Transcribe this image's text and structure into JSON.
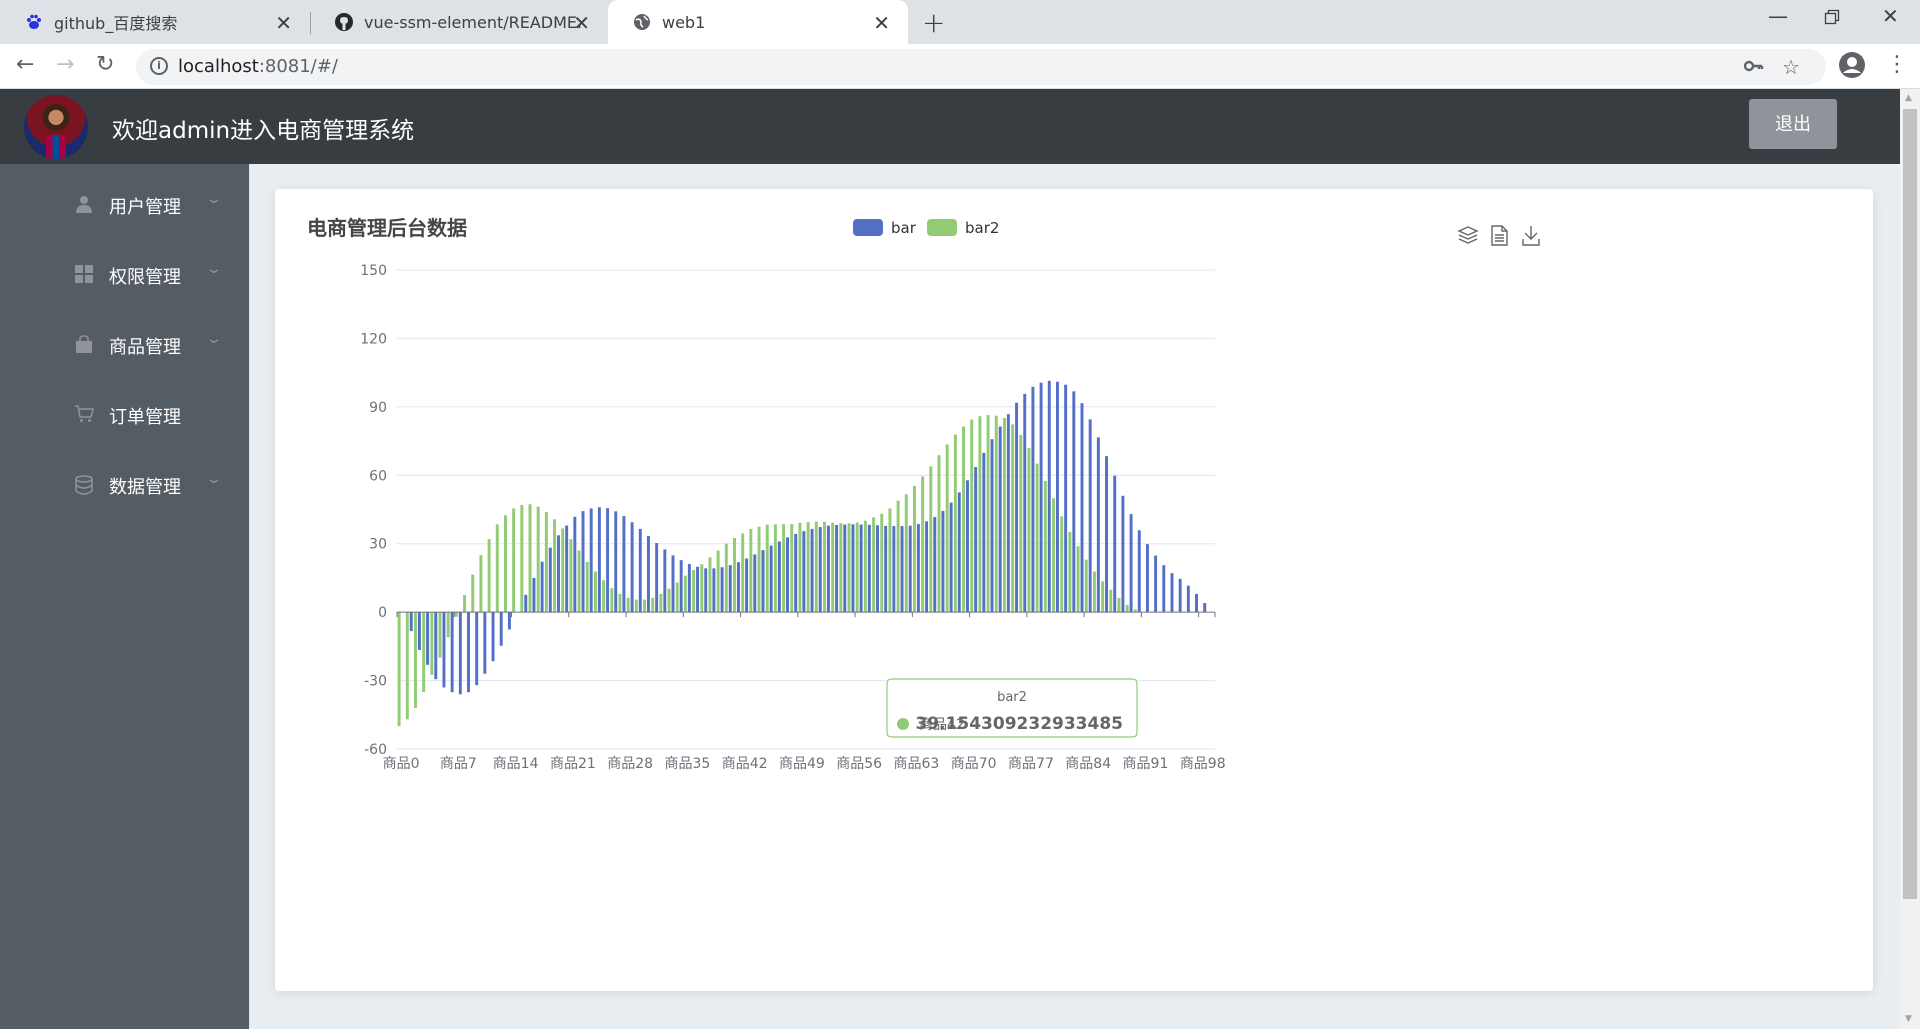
{
  "browser": {
    "tabs": [
      {
        "title": "github_百度搜索",
        "icon": "baidu-paw-icon"
      },
      {
        "title": "vue-ssm-element/README.md",
        "icon": "github-icon"
      },
      {
        "title": "web1",
        "icon": "globe-icon"
      }
    ],
    "url_host": "localhost",
    "url_path": ":8081/#/"
  },
  "header": {
    "title": "欢迎admin进入电商管理系统",
    "logout_label": "退出"
  },
  "sidebar": {
    "items": [
      {
        "label": "用户管理",
        "icon": "user-icon",
        "has_submenu": true
      },
      {
        "label": "权限管理",
        "icon": "grid-icon",
        "has_submenu": true
      },
      {
        "label": "商品管理",
        "icon": "bag-icon",
        "has_submenu": true
      },
      {
        "label": "订单管理",
        "icon": "cart-icon",
        "has_submenu": false
      },
      {
        "label": "数据管理",
        "icon": "database-icon",
        "has_submenu": true
      }
    ]
  },
  "colors": {
    "bar": "#5470c6",
    "bar2": "#91cc75",
    "header_bg": "#373d41",
    "sidebar_bg": "#545c64"
  },
  "toolbox": [
    "magic-type-stack-icon",
    "data-view-icon",
    "save-image-icon"
  ],
  "tooltip": {
    "series": "bar2",
    "category": "商品42",
    "value": "39.154309232933485"
  },
  "chart_data": {
    "type": "bar",
    "title": "电商管理后台数据",
    "legend": [
      "bar",
      "bar2"
    ],
    "legend_position": "top-center",
    "ylim": [
      -60,
      150
    ],
    "yticks": [
      -60,
      -30,
      0,
      30,
      60,
      90,
      120,
      150
    ],
    "x_tick_labels": [
      "商品0",
      "商品7",
      "商品14",
      "商品21",
      "商品28",
      "商品35",
      "商品42",
      "商品49",
      "商品56",
      "商品63",
      "商品70",
      "商品77",
      "商品84",
      "商品91",
      "商品98"
    ],
    "x_category_prefix": "商品",
    "x_count": 100,
    "grid": true,
    "series": [
      {
        "name": "bar",
        "values": [
          0,
          -8.3,
          -16.6,
          -23.1,
          -29.4,
          -33.0,
          -35.1,
          -36.0,
          -35.1,
          -32.0,
          -27.0,
          -21.5,
          -14.7,
          -7.6,
          0,
          7.6,
          15.0,
          22.1,
          28.3,
          33.7,
          38.0,
          41.8,
          44.3,
          45.5,
          46.0,
          45.6,
          44.2,
          42.1,
          39.4,
          36.5,
          33.4,
          30.3,
          27.5,
          24.9,
          22.8,
          21.1,
          19.9,
          19.2,
          19.2,
          19.7,
          20.6,
          21.9,
          23.5,
          25.3,
          27.2,
          29.2,
          31.0,
          32.8,
          34.3,
          35.5,
          36.5,
          37.3,
          37.9,
          38.2,
          38.4,
          38.5,
          38.4,
          38.3,
          38.1,
          37.8,
          37.7,
          37.7,
          37.9,
          38.6,
          39.8,
          41.7,
          44.4,
          48.0,
          52.5,
          57.8,
          63.6,
          69.8,
          75.8,
          81.4,
          86.8,
          91.8,
          95.7,
          98.8,
          100.6,
          101.4,
          101.0,
          99.7,
          96.8,
          91.6,
          84.5,
          76.6,
          68.4,
          59.8,
          51.0,
          43.0,
          35.9,
          29.8,
          24.8,
          20.6,
          17.1,
          14.6,
          11.6,
          8.0,
          4.0,
          0
        ]
      },
      {
        "name": "bar2",
        "values": [
          -50.0,
          -47.0,
          -42.0,
          -35.0,
          -27.5,
          -20.0,
          -11.0,
          -2.0,
          7.5,
          16.5,
          25.0,
          32.0,
          38.5,
          42.5,
          45.5,
          47.0,
          47.3,
          46.3,
          43.9,
          40.7,
          36.7,
          32.0,
          27.0,
          22.0,
          17.8,
          14.0,
          10.5,
          8.0,
          6.3,
          5.5,
          5.5,
          6.3,
          8.0,
          10.3,
          13.0,
          16.0,
          18.5,
          21.0,
          24.0,
          27.0,
          30.0,
          32.5,
          34.5,
          36.5,
          37.5,
          38.4,
          38.5,
          38.6,
          38.6,
          39.2,
          39.5,
          39.7,
          39.6,
          39.2,
          39.0,
          39.0,
          39.3,
          40.1,
          41.5,
          43.1,
          45.5,
          48.9,
          51.7,
          55.3,
          59.5,
          63.9,
          68.8,
          73.5,
          77.9,
          81.4,
          84.4,
          85.9,
          86.4,
          86.1,
          85.1,
          82.3,
          77.7,
          71.9,
          65.1,
          57.5,
          49.9,
          42.0,
          35.2,
          28.9,
          23.0,
          17.8,
          13.5,
          9.8,
          6.2,
          3.2,
          1.2,
          0,
          0,
          0,
          0,
          0,
          0,
          0,
          0,
          0
        ]
      }
    ]
  }
}
